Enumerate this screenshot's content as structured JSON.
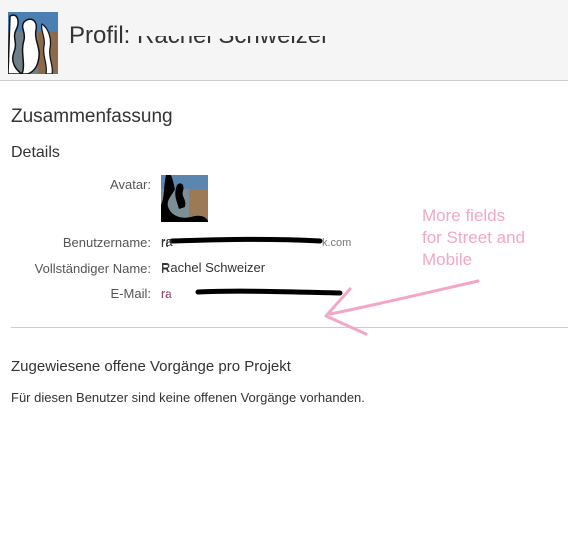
{
  "header": {
    "title_prefix": "Profil: ",
    "title_name": "Rachel Schweizer",
    "avatar_icon": "user-avatar-icon"
  },
  "summary": {
    "title": "Zusammenfassung",
    "details_title": "Details",
    "fields": {
      "avatar_label": "Avatar:",
      "username_label": "Benutzername:",
      "username_value": "rachel.schweizer@outlook.com",
      "fullname_label": "Vollständiger Name:",
      "fullname_value": "Rachel Schweizer",
      "email_label": "E-Mail:",
      "email_value": "rachel.schweizer@outlook.com"
    }
  },
  "issues": {
    "title": "Zugewiesene offene Vorgänge pro Projekt",
    "empty_text": "Für diesen Benutzer sind keine offenen Vorgänge vorhanden."
  },
  "annotation": {
    "text": "More fields\nfor Street and\nMobile",
    "color": "#f4a6c6"
  },
  "colors": {
    "header_bg": "#f5f5f5",
    "divider": "#cccccc",
    "link": "#9b4a76",
    "redaction": "#000000"
  }
}
